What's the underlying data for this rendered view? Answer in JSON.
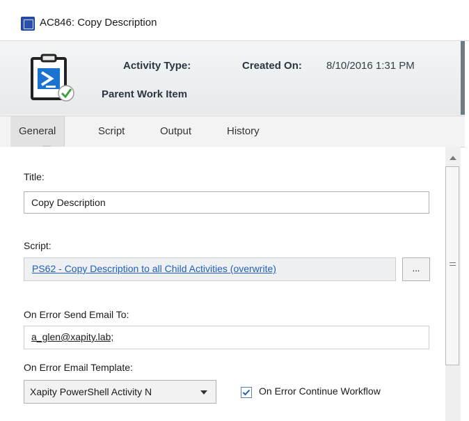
{
  "window": {
    "title": "AC846: Copy Description",
    "icon": "powershell-app-icon"
  },
  "header": {
    "icon": "powershell-activity-icon",
    "activity_type_label": "Activity Type:",
    "parent_work_item_label": "Parent Work Item",
    "created_on_label": "Created On:",
    "created_on_value": "8/10/2016 1:31 PM"
  },
  "tabs": [
    {
      "label": "General",
      "active": true
    },
    {
      "label": "Script",
      "active": false
    },
    {
      "label": "Output",
      "active": false
    },
    {
      "label": "History",
      "active": false
    }
  ],
  "form": {
    "title_label": "Title:",
    "title_value": "Copy Description",
    "script_label": "Script:",
    "script_link": "PS62 - Copy Description to all Child Activities (overwrite)",
    "browse_button": "...",
    "email_label": "On Error Send Email To:",
    "email_value": "a_glen@xapity.lab;",
    "template_label": "On Error Email Template:",
    "template_value": "Xapity PowerShell Activity N",
    "continue_label": "On Error Continue Workflow",
    "continue_checked": true
  },
  "colors": {
    "accent": "#2a4fae",
    "link": "#1f5fbf",
    "check_green": "#3da33d"
  }
}
